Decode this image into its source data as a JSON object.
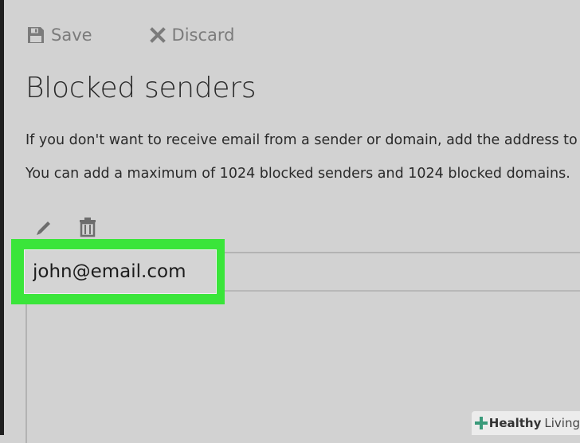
{
  "toolbar": {
    "save_label": "Save",
    "save_icon": "floppy-disk-icon",
    "discard_label": "Discard",
    "discard_icon": "x-icon"
  },
  "page": {
    "title": "Blocked senders",
    "description_1": "If you don't want to receive email from a sender or domain, add the address to",
    "description_2": "You can add a maximum of 1024 blocked senders and 1024 blocked domains."
  },
  "list_actions": {
    "edit_icon": "pencil-icon",
    "delete_icon": "trash-icon"
  },
  "entry": {
    "value": "john@email.com"
  },
  "watermark": {
    "brand_strong": "Healthy",
    "brand_light": "Living"
  },
  "colors": {
    "background": "#d2d2d2",
    "highlight": "#3ae53a",
    "toolbar_text": "#7b7b7b",
    "body_text": "#2a2a2a"
  }
}
